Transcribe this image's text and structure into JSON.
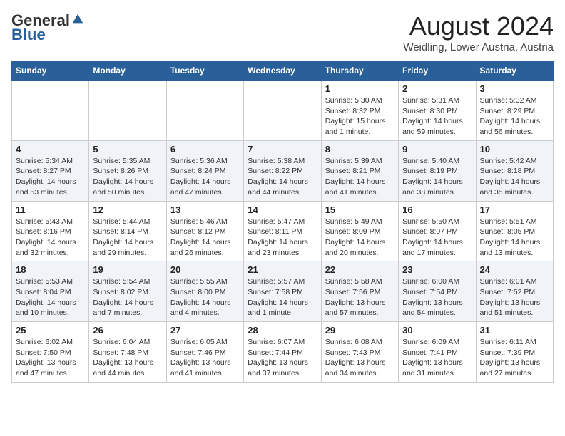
{
  "logo": {
    "general": "General",
    "blue": "Blue"
  },
  "title": "August 2024",
  "location": "Weidling, Lower Austria, Austria",
  "days_of_week": [
    "Sunday",
    "Monday",
    "Tuesday",
    "Wednesday",
    "Thursday",
    "Friday",
    "Saturday"
  ],
  "weeks": [
    [
      {
        "day": "",
        "info": ""
      },
      {
        "day": "",
        "info": ""
      },
      {
        "day": "",
        "info": ""
      },
      {
        "day": "",
        "info": ""
      },
      {
        "day": "1",
        "info": "Sunrise: 5:30 AM\nSunset: 8:32 PM\nDaylight: 15 hours\nand 1 minute."
      },
      {
        "day": "2",
        "info": "Sunrise: 5:31 AM\nSunset: 8:30 PM\nDaylight: 14 hours\nand 59 minutes."
      },
      {
        "day": "3",
        "info": "Sunrise: 5:32 AM\nSunset: 8:29 PM\nDaylight: 14 hours\nand 56 minutes."
      }
    ],
    [
      {
        "day": "4",
        "info": "Sunrise: 5:34 AM\nSunset: 8:27 PM\nDaylight: 14 hours\nand 53 minutes."
      },
      {
        "day": "5",
        "info": "Sunrise: 5:35 AM\nSunset: 8:26 PM\nDaylight: 14 hours\nand 50 minutes."
      },
      {
        "day": "6",
        "info": "Sunrise: 5:36 AM\nSunset: 8:24 PM\nDaylight: 14 hours\nand 47 minutes."
      },
      {
        "day": "7",
        "info": "Sunrise: 5:38 AM\nSunset: 8:22 PM\nDaylight: 14 hours\nand 44 minutes."
      },
      {
        "day": "8",
        "info": "Sunrise: 5:39 AM\nSunset: 8:21 PM\nDaylight: 14 hours\nand 41 minutes."
      },
      {
        "day": "9",
        "info": "Sunrise: 5:40 AM\nSunset: 8:19 PM\nDaylight: 14 hours\nand 38 minutes."
      },
      {
        "day": "10",
        "info": "Sunrise: 5:42 AM\nSunset: 8:18 PM\nDaylight: 14 hours\nand 35 minutes."
      }
    ],
    [
      {
        "day": "11",
        "info": "Sunrise: 5:43 AM\nSunset: 8:16 PM\nDaylight: 14 hours\nand 32 minutes."
      },
      {
        "day": "12",
        "info": "Sunrise: 5:44 AM\nSunset: 8:14 PM\nDaylight: 14 hours\nand 29 minutes."
      },
      {
        "day": "13",
        "info": "Sunrise: 5:46 AM\nSunset: 8:12 PM\nDaylight: 14 hours\nand 26 minutes."
      },
      {
        "day": "14",
        "info": "Sunrise: 5:47 AM\nSunset: 8:11 PM\nDaylight: 14 hours\nand 23 minutes."
      },
      {
        "day": "15",
        "info": "Sunrise: 5:49 AM\nSunset: 8:09 PM\nDaylight: 14 hours\nand 20 minutes."
      },
      {
        "day": "16",
        "info": "Sunrise: 5:50 AM\nSunset: 8:07 PM\nDaylight: 14 hours\nand 17 minutes."
      },
      {
        "day": "17",
        "info": "Sunrise: 5:51 AM\nSunset: 8:05 PM\nDaylight: 14 hours\nand 13 minutes."
      }
    ],
    [
      {
        "day": "18",
        "info": "Sunrise: 5:53 AM\nSunset: 8:04 PM\nDaylight: 14 hours\nand 10 minutes."
      },
      {
        "day": "19",
        "info": "Sunrise: 5:54 AM\nSunset: 8:02 PM\nDaylight: 14 hours\nand 7 minutes."
      },
      {
        "day": "20",
        "info": "Sunrise: 5:55 AM\nSunset: 8:00 PM\nDaylight: 14 hours\nand 4 minutes."
      },
      {
        "day": "21",
        "info": "Sunrise: 5:57 AM\nSunset: 7:58 PM\nDaylight: 14 hours\nand 1 minute."
      },
      {
        "day": "22",
        "info": "Sunrise: 5:58 AM\nSunset: 7:56 PM\nDaylight: 13 hours\nand 57 minutes."
      },
      {
        "day": "23",
        "info": "Sunrise: 6:00 AM\nSunset: 7:54 PM\nDaylight: 13 hours\nand 54 minutes."
      },
      {
        "day": "24",
        "info": "Sunrise: 6:01 AM\nSunset: 7:52 PM\nDaylight: 13 hours\nand 51 minutes."
      }
    ],
    [
      {
        "day": "25",
        "info": "Sunrise: 6:02 AM\nSunset: 7:50 PM\nDaylight: 13 hours\nand 47 minutes."
      },
      {
        "day": "26",
        "info": "Sunrise: 6:04 AM\nSunset: 7:48 PM\nDaylight: 13 hours\nand 44 minutes."
      },
      {
        "day": "27",
        "info": "Sunrise: 6:05 AM\nSunset: 7:46 PM\nDaylight: 13 hours\nand 41 minutes."
      },
      {
        "day": "28",
        "info": "Sunrise: 6:07 AM\nSunset: 7:44 PM\nDaylight: 13 hours\nand 37 minutes."
      },
      {
        "day": "29",
        "info": "Sunrise: 6:08 AM\nSunset: 7:43 PM\nDaylight: 13 hours\nand 34 minutes."
      },
      {
        "day": "30",
        "info": "Sunrise: 6:09 AM\nSunset: 7:41 PM\nDaylight: 13 hours\nand 31 minutes."
      },
      {
        "day": "31",
        "info": "Sunrise: 6:11 AM\nSunset: 7:39 PM\nDaylight: 13 hours\nand 27 minutes."
      }
    ]
  ]
}
